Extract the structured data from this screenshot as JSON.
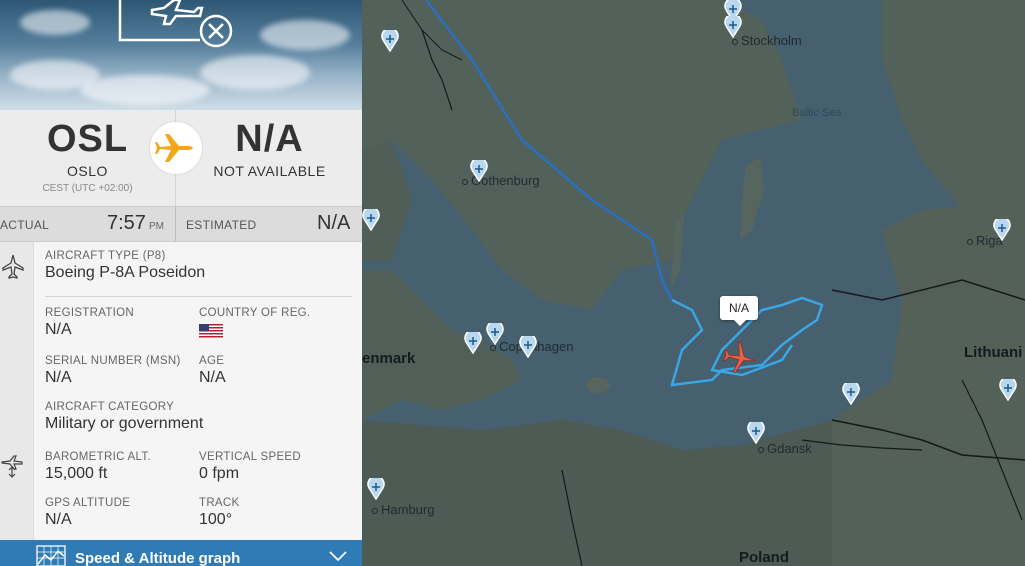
{
  "map": {
    "cities": [
      {
        "id": "stockholm",
        "name": "Stockholm"
      },
      {
        "id": "gothenburg",
        "name": "Gothenburg"
      },
      {
        "id": "copenhagen",
        "name": "Copenhagen"
      },
      {
        "id": "gdansk",
        "name": "Gdansk"
      },
      {
        "id": "hamburg",
        "name": "Hamburg"
      },
      {
        "id": "riga",
        "name": "Riga"
      }
    ],
    "countries": {
      "denmark": "enmark",
      "lithuania": "Lithuani",
      "poland": "Poland"
    },
    "sea": "Baltic Sea",
    "flight_tag": "N/A",
    "colors": {
      "track_dark": "#2a6fc0",
      "track_light": "#3aa6e6",
      "aircraft": "#e0604a"
    }
  },
  "panel": {
    "origin": {
      "code": "OSL",
      "city": "OSLO",
      "timezone": "CEST (UTC +02:00)"
    },
    "destination": {
      "code": "N/A",
      "city": "NOT AVAILABLE"
    },
    "actual": {
      "label": "ACTUAL",
      "time": "7:57",
      "unit": "PM"
    },
    "estimated": {
      "label": "ESTIMATED",
      "value": "N/A"
    },
    "aircraft_type": {
      "label": "AIRCRAFT TYPE (P8)",
      "value": "Boeing P-8A Poseidon"
    },
    "registration": {
      "label": "REGISTRATION",
      "value": "N/A"
    },
    "country_of_reg": {
      "label": "COUNTRY OF REG.",
      "flag": "us-flag"
    },
    "serial": {
      "label": "SERIAL NUMBER (MSN)",
      "value": "N/A"
    },
    "age": {
      "label": "AGE",
      "value": "N/A"
    },
    "category": {
      "label": "AIRCRAFT CATEGORY",
      "value": "Military or government"
    },
    "baro_alt": {
      "label": "BAROMETRIC ALT.",
      "value": "15,000 ft"
    },
    "vert_speed": {
      "label": "VERTICAL SPEED",
      "value": "0 fpm"
    },
    "gps_alt": {
      "label": "GPS ALTITUDE",
      "value": "N/A"
    },
    "track": {
      "label": "TRACK",
      "value": "100°"
    },
    "graph_button": "Speed & Altitude graph"
  }
}
